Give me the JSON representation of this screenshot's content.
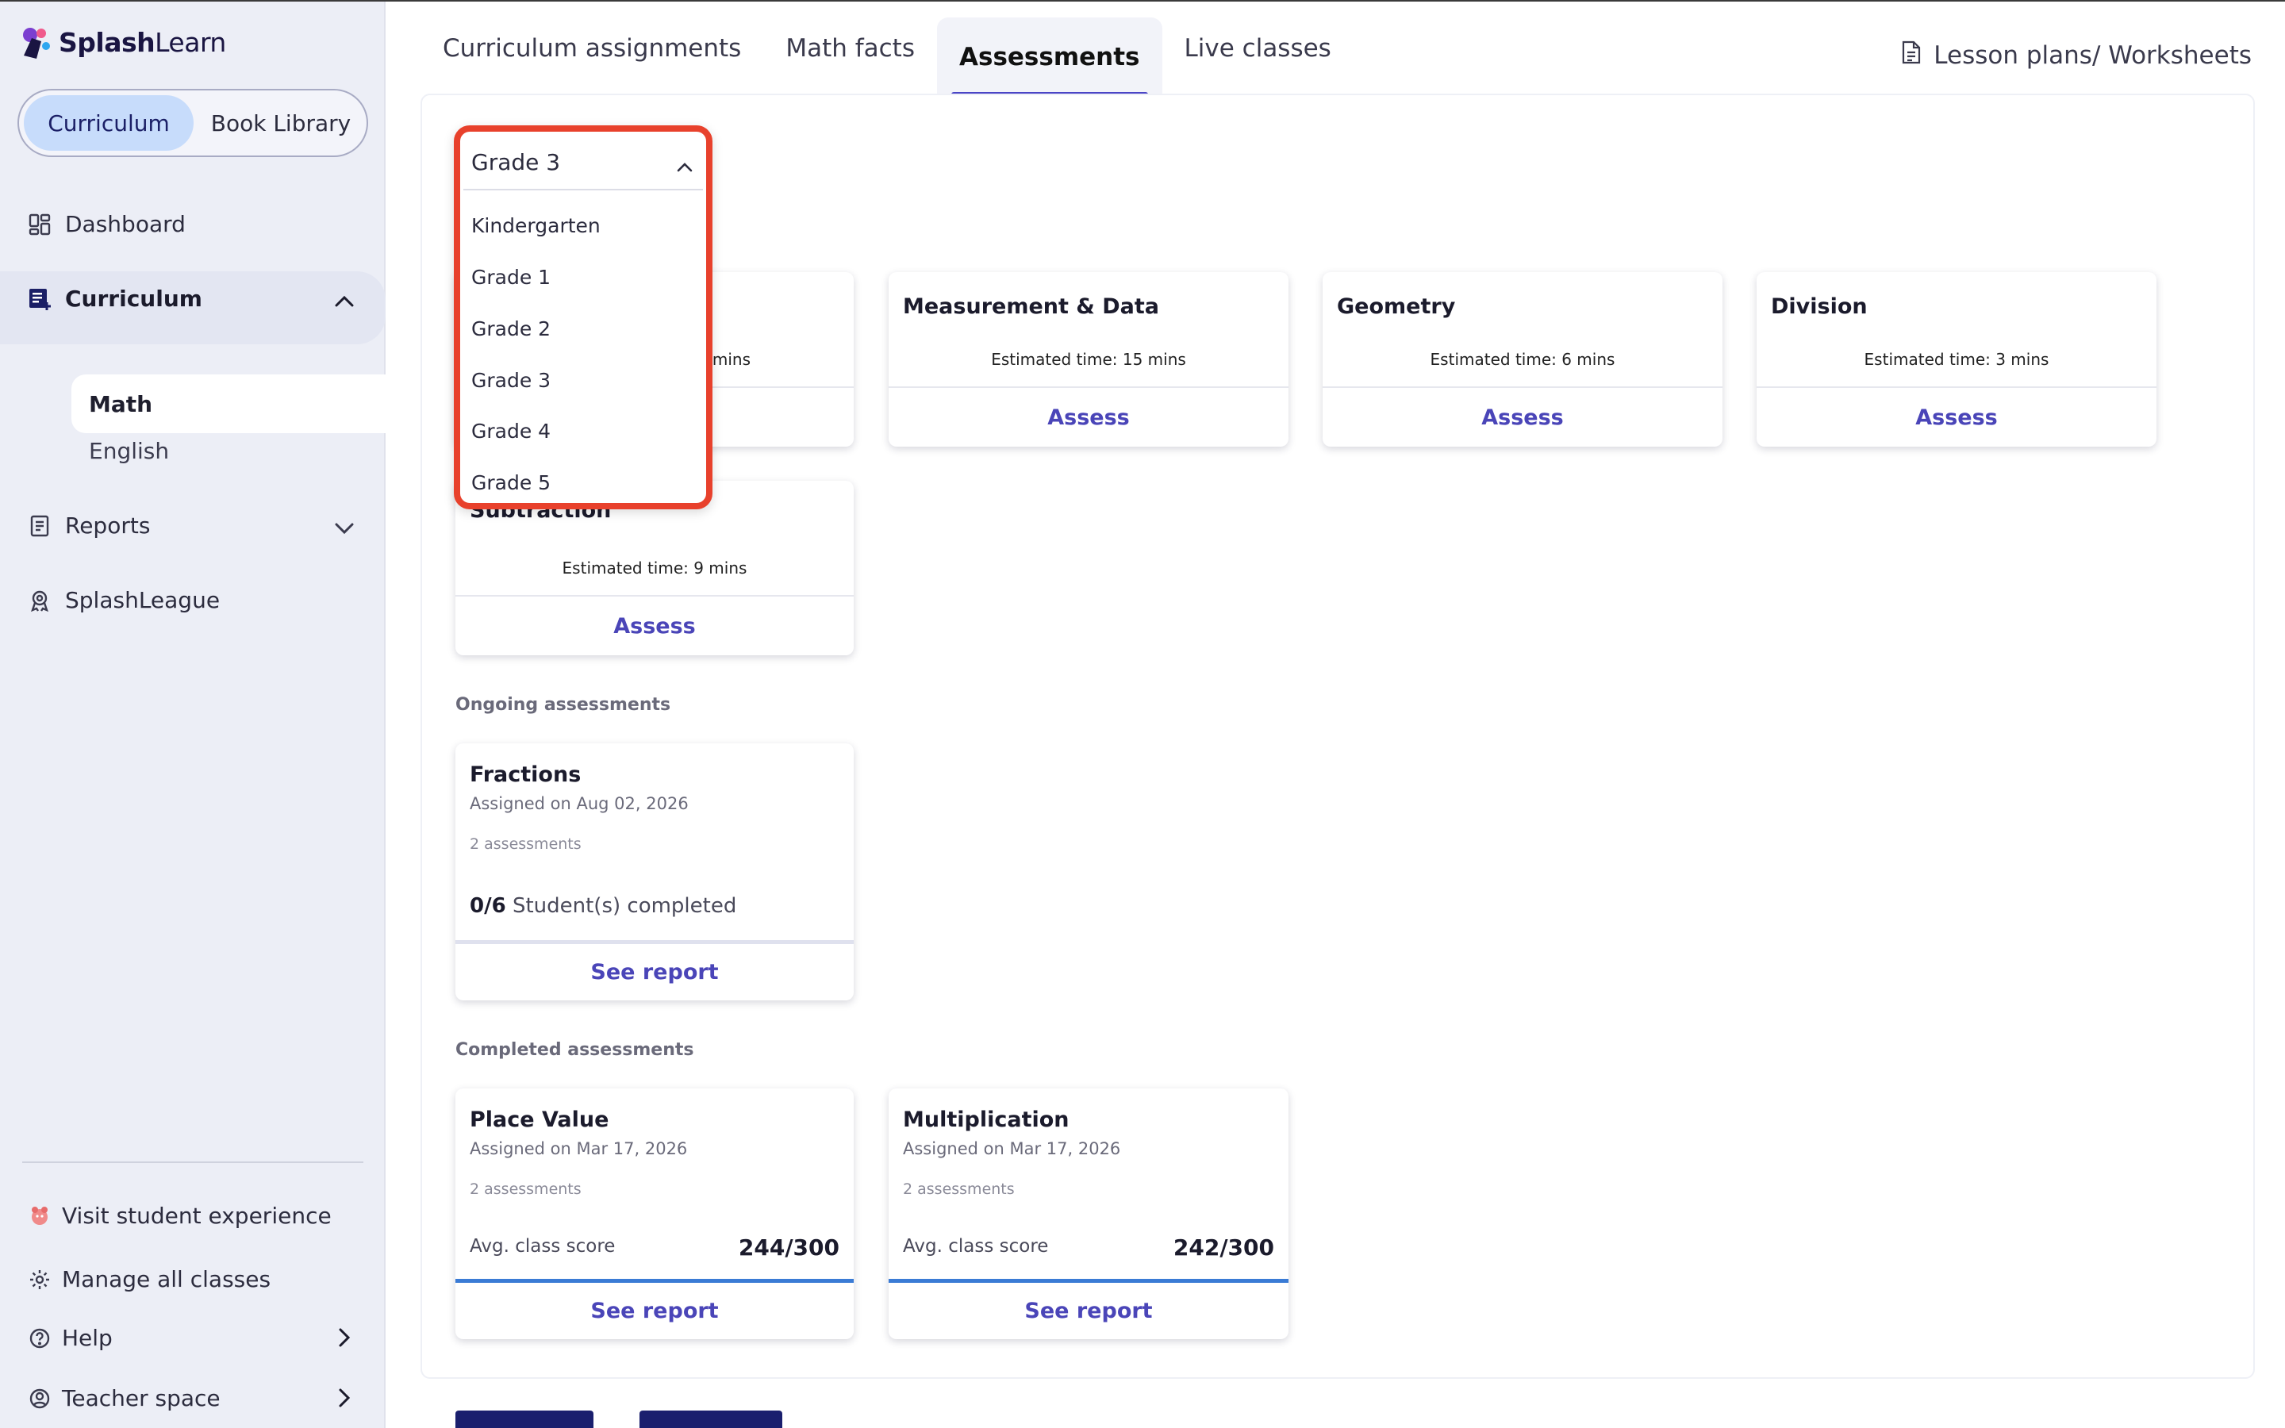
{
  "app": {
    "brand_bold": "Splash",
    "brand_light": "Learn"
  },
  "sidebar": {
    "segments": [
      "Curriculum",
      "Book Library"
    ],
    "items": {
      "dashboard": "Dashboard",
      "curriculum": "Curriculum",
      "math": "Math",
      "english": "English",
      "reports": "Reports",
      "splashleague": "SplashLeague"
    },
    "bottom": {
      "visit": "Visit student experience",
      "manage": "Manage all classes",
      "help": "Help",
      "teacher": "Teacher space"
    }
  },
  "tabs": [
    "Curriculum assignments",
    "Math facts",
    "Assessments",
    "Live classes"
  ],
  "active_tab": "Assessments",
  "lesson_link": "Lesson plans/ Worksheets",
  "grade_dropdown": {
    "selected": "Grade 3",
    "options": [
      "Kindergarten",
      "Grade 1",
      "Grade 2",
      "Grade 3",
      "Grade 4",
      "Grade 5"
    ]
  },
  "available": [
    {
      "title": "",
      "time": "mins",
      "action": "Assess"
    },
    {
      "title": "Measurement & Data",
      "time": "Estimated time: 15 mins",
      "action": "Assess"
    },
    {
      "title": "Geometry",
      "time": "Estimated time: 6 mins",
      "action": "Assess"
    },
    {
      "title": "Division",
      "time": "Estimated time: 3 mins",
      "action": "Assess"
    },
    {
      "title": "Subtraction",
      "time": "Estimated time: 9 mins",
      "action": "Assess"
    }
  ],
  "ongoing_label": "Ongoing assessments",
  "ongoing": [
    {
      "title": "Fractions",
      "date": "Assigned on Aug 02, 2026",
      "count": "2 assessments",
      "done": "0/6",
      "done_suffix": "Student(s) completed",
      "progress": 0,
      "action": "See report"
    }
  ],
  "completed_label": "Completed assessments",
  "completed": [
    {
      "title": "Place Value",
      "date": "Assigned on Mar 17, 2026",
      "count": "2 assessments",
      "score_label": "Avg. class score",
      "score": "244/300",
      "action": "See report"
    },
    {
      "title": "Multiplication",
      "date": "Assigned on Mar 17, 2026",
      "count": "2 assessments",
      "score_label": "Avg. class score",
      "score": "242/300",
      "action": "See report"
    }
  ],
  "colors": {
    "accent": "#4a45b8",
    "highlight": "#e8412c",
    "sidebar_bg": "#eceef6",
    "segment_active": "#c7dcfb"
  }
}
